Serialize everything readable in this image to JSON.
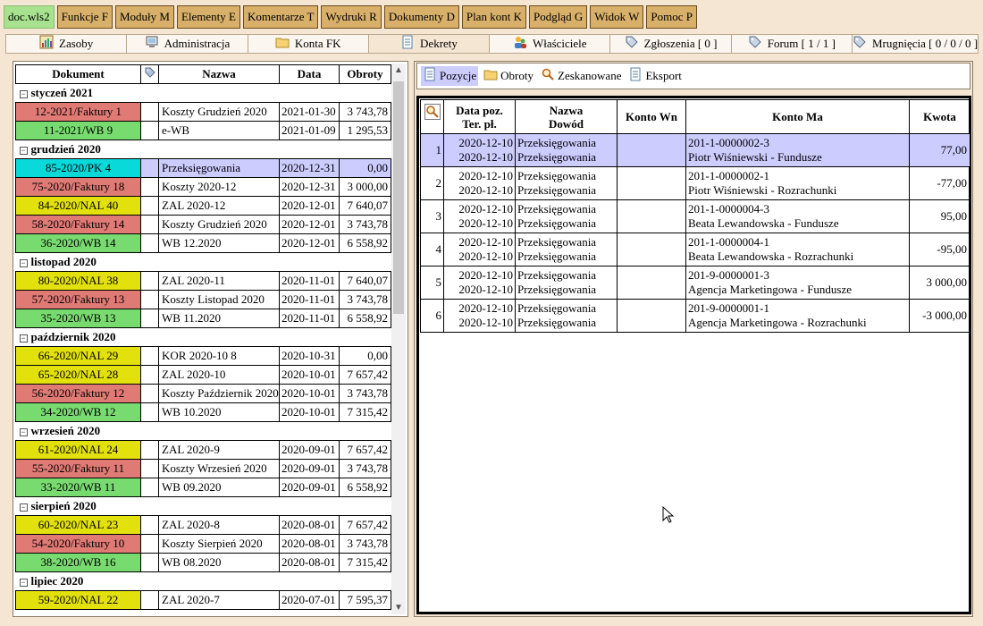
{
  "top_menu": [
    {
      "label": "doc.wls2",
      "active": true
    },
    {
      "label": "Funkcje F"
    },
    {
      "label": "Moduły M"
    },
    {
      "label": "Elementy E"
    },
    {
      "label": "Komentarze T"
    },
    {
      "label": "Wydruki R"
    },
    {
      "label": "Dokumenty D"
    },
    {
      "label": "Plan kont K"
    },
    {
      "label": "Podgląd G"
    },
    {
      "label": "Widok W"
    },
    {
      "label": "Pomoc P"
    }
  ],
  "tabs": [
    {
      "label": "Zasoby",
      "icon": "chart-icon"
    },
    {
      "label": "Administracja",
      "icon": "computer-icon"
    },
    {
      "label": "Konta FK",
      "icon": "folder-icon"
    },
    {
      "label": "Dekrety",
      "icon": "document-icon",
      "active": true
    },
    {
      "label": "Właściciele",
      "icon": "users-icon"
    },
    {
      "label": "Zgłoszenia [ 0 ]",
      "icon": "tag-icon"
    },
    {
      "label": "Forum [ 1 / 1 ]",
      "icon": "tag-icon"
    },
    {
      "label": "Mrugnięcia [ 0 / 0 / 0 ]",
      "icon": "tag-icon"
    }
  ],
  "left_table": {
    "headers": {
      "doc": "Dokument",
      "name": "Nazwa",
      "date": "Data",
      "amount": "Obroty"
    },
    "groups": [
      {
        "label": "styczeń 2021",
        "rows": [
          {
            "doc": "12-2021/Faktury 1",
            "color": "red",
            "name": "Koszty Grudzień 2020",
            "date": "2021-01-30",
            "amount": "3 743,78"
          },
          {
            "doc": "11-2021/WB 9",
            "color": "green",
            "name": "e-WB",
            "date": "2021-01-09",
            "amount": "1 295,53"
          }
        ]
      },
      {
        "label": "grudzień 2020",
        "rows": [
          {
            "doc": "85-2020/PK 4",
            "color": "cyan",
            "name": "Przeksięgowania",
            "date": "2020-12-31",
            "amount": "0,00",
            "selected": true
          },
          {
            "doc": "75-2020/Faktury 18",
            "color": "red",
            "name": "Koszty 2020-12",
            "date": "2020-12-31",
            "amount": "3 000,00"
          },
          {
            "doc": "84-2020/NAL 40",
            "color": "yellow",
            "name": "ZAL 2020-12",
            "date": "2020-12-01",
            "amount": "7 640,07"
          },
          {
            "doc": "58-2020/Faktury 14",
            "color": "red",
            "name": "Koszty Grudzień 2020",
            "date": "2020-12-01",
            "amount": "3 743,78"
          },
          {
            "doc": "36-2020/WB 14",
            "color": "green",
            "name": "WB 12.2020",
            "date": "2020-12-01",
            "amount": "6 558,92"
          }
        ]
      },
      {
        "label": "listopad 2020",
        "rows": [
          {
            "doc": "80-2020/NAL 38",
            "color": "yellow",
            "name": "ZAL 2020-11",
            "date": "2020-11-01",
            "amount": "7 640,07"
          },
          {
            "doc": "57-2020/Faktury 13",
            "color": "red",
            "name": "Koszty Listopad 2020",
            "date": "2020-11-01",
            "amount": "3 743,78"
          },
          {
            "doc": "35-2020/WB 13",
            "color": "green",
            "name": "WB 11.2020",
            "date": "2020-11-01",
            "amount": "6 558,92"
          }
        ]
      },
      {
        "label": "październik 2020",
        "rows": [
          {
            "doc": "66-2020/NAL 29",
            "color": "yellow",
            "name": "KOR 2020-10 8",
            "date": "2020-10-31",
            "amount": "0,00"
          },
          {
            "doc": "65-2020/NAL 28",
            "color": "yellow",
            "name": "ZAL 2020-10",
            "date": "2020-10-01",
            "amount": "7 657,42"
          },
          {
            "doc": "56-2020/Faktury 12",
            "color": "red",
            "name": "Koszty Październik 2020",
            "date": "2020-10-01",
            "amount": "3 743,78"
          },
          {
            "doc": "34-2020/WB 12",
            "color": "green",
            "name": "WB 10.2020",
            "date": "2020-10-01",
            "amount": "7 315,42"
          }
        ]
      },
      {
        "label": "wrzesień 2020",
        "rows": [
          {
            "doc": "61-2020/NAL 24",
            "color": "yellow",
            "name": "ZAL 2020-9",
            "date": "2020-09-01",
            "amount": "7 657,42"
          },
          {
            "doc": "55-2020/Faktury 11",
            "color": "red",
            "name": "Koszty Wrzesień 2020",
            "date": "2020-09-01",
            "amount": "3 743,78"
          },
          {
            "doc": "33-2020/WB 11",
            "color": "green",
            "name": "WB 09.2020",
            "date": "2020-09-01",
            "amount": "6 558,92"
          }
        ]
      },
      {
        "label": "sierpień 2020",
        "rows": [
          {
            "doc": "60-2020/NAL 23",
            "color": "yellow",
            "name": "ZAL 2020-8",
            "date": "2020-08-01",
            "amount": "7 657,42"
          },
          {
            "doc": "54-2020/Faktury 10",
            "color": "red",
            "name": "Koszty Sierpień 2020",
            "date": "2020-08-01",
            "amount": "3 743,78"
          },
          {
            "doc": "38-2020/WB 16",
            "color": "green",
            "name": "WB 08.2020",
            "date": "2020-08-01",
            "amount": "7 315,42"
          }
        ]
      },
      {
        "label": "lipiec 2020",
        "rows": [
          {
            "doc": "59-2020/NAL 22",
            "color": "yellow",
            "name": "ZAL 2020-7",
            "date": "2020-07-01",
            "amount": "7 595,37"
          }
        ]
      }
    ]
  },
  "right_toolbar": [
    {
      "label": "Pozycje",
      "icon": "document-icon",
      "active": true
    },
    {
      "label": "Obroty",
      "icon": "folder-icon"
    },
    {
      "label": "Zeskanowane",
      "icon": "magnifier-icon"
    },
    {
      "label": "Eksport",
      "icon": "document-icon"
    }
  ],
  "positions_table": {
    "headers": {
      "date": [
        "Data poz.",
        "Ter. pł."
      ],
      "doc": [
        "Nazwa",
        "Dowód"
      ],
      "wn": "Konto Wn",
      "ma": "Konto Ma",
      "amount": "Kwota"
    },
    "rows": [
      {
        "lp": "1",
        "date1": "2020-12-10",
        "date2": "2020-12-10",
        "doc1": "Przeksięgowania",
        "doc2": "Przeksięgowania",
        "wn": "",
        "ma1": "201-1-0000002-3",
        "ma2": "Piotr Wiśniewski - Fundusze",
        "amount": "77,00",
        "selected": true
      },
      {
        "lp": "2",
        "date1": "2020-12-10",
        "date2": "2020-12-10",
        "doc1": "Przeksięgowania",
        "doc2": "Przeksięgowania",
        "wn": "",
        "ma1": "201-1-0000002-1",
        "ma2": "Piotr Wiśniewski - Rozrachunki",
        "amount": "-77,00"
      },
      {
        "lp": "3",
        "date1": "2020-12-10",
        "date2": "2020-12-10",
        "doc1": "Przeksięgowania",
        "doc2": "Przeksięgowania",
        "wn": "",
        "ma1": "201-1-0000004-3",
        "ma2": "Beata Lewandowska - Fundusze",
        "amount": "95,00"
      },
      {
        "lp": "4",
        "date1": "2020-12-10",
        "date2": "2020-12-10",
        "doc1": "Przeksięgowania",
        "doc2": "Przeksięgowania",
        "wn": "",
        "ma1": "201-1-0000004-1",
        "ma2": "Beata Lewandowska - Rozrachunki",
        "amount": "-95,00"
      },
      {
        "lp": "5",
        "date1": "2020-12-10",
        "date2": "2020-12-10",
        "doc1": "Przeksięgowania",
        "doc2": "Przeksięgowania",
        "wn": "",
        "ma1": "201-9-0000001-3",
        "ma2": "Agencja Marketingowa - Fundusze",
        "amount": "3 000,00"
      },
      {
        "lp": "6",
        "date1": "2020-12-10",
        "date2": "2020-12-10",
        "doc1": "Przeksięgowania",
        "doc2": "Przeksięgowania",
        "wn": "",
        "ma1": "201-9-0000001-1",
        "ma2": "Agencja Marketingowa - Rozrachunki",
        "amount": "-3 000,00"
      }
    ]
  }
}
